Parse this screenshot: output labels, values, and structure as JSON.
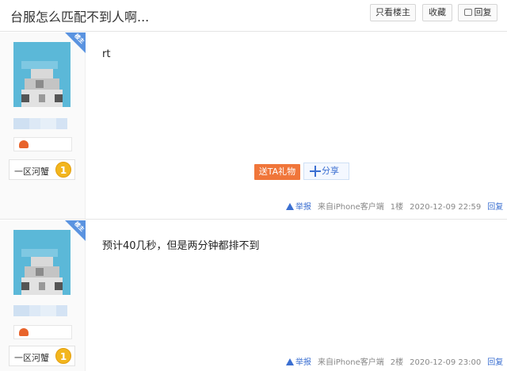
{
  "header": {
    "title": "台服怎么匹配不到人啊...",
    "only_louzhu": "只看楼主",
    "favorite": "收藏",
    "reply": "回复"
  },
  "posts": [
    {
      "badge": "楼主",
      "rank_title": "一区河蟹",
      "level": "1",
      "content": "rt",
      "gift_label": "送TA礼物",
      "share_label": "分享",
      "report_label": "举报",
      "source": "来自iPhone客户端",
      "floor": "1楼",
      "time": "2020-12-09 22:59",
      "reply_label": "回复"
    },
    {
      "badge": "楼主",
      "rank_title": "一区河蟹",
      "level": "1",
      "content": "预计40几秒，但是两分钟都排不到",
      "report_label": "举报",
      "source": "来自iPhone客户端",
      "floor": "2楼",
      "time": "2020-12-09 23:00",
      "reply_label": "回复"
    }
  ],
  "colors": {
    "accent_blue": "#3b6fd1",
    "gift_orange": "#f0763a",
    "level_gold": "#f2b61e",
    "badge_blue": "#5a93e0"
  }
}
